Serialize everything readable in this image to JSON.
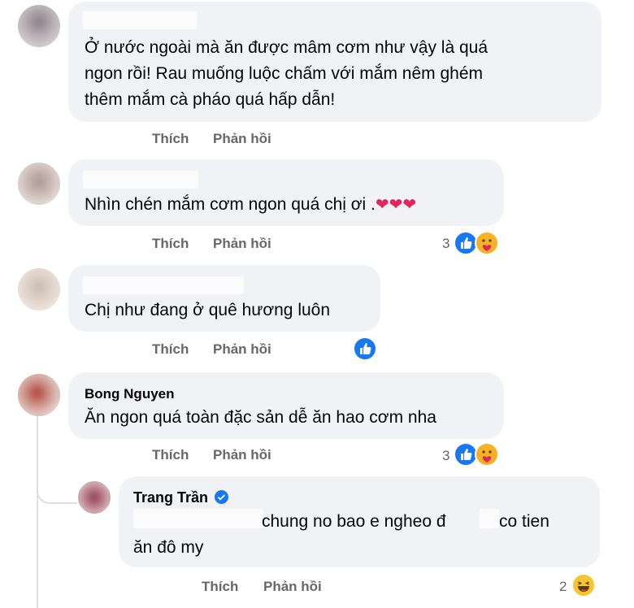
{
  "comments": [
    {
      "text_lines": [
        "Ở nước ngoài mà ăn được mâm cơm như vậy là quá",
        "ngon rồi! Rau muống luộc chấm với mắm nêm ghém",
        "thêm mắm cà pháo quá hấp dẫn!"
      ],
      "actions": {
        "like": "Thích",
        "reply": "Phản hồi"
      }
    },
    {
      "text": "Nhìn chén mắm cơm ngon quá chị ơi .",
      "hearts": "❤❤❤",
      "actions": {
        "like": "Thích",
        "reply": "Phản hồi"
      },
      "reaction_count": "3",
      "reactions": [
        "like-icon",
        "care-icon"
      ]
    },
    {
      "text": "Chị như đang ở quê hương luôn",
      "actions": {
        "like": "Thích",
        "reply": "Phản hồi"
      },
      "reactions": [
        "like-icon"
      ]
    },
    {
      "author": "Bong Nguyen",
      "text": "Ăn ngon quá toàn đặc sản dễ ăn hao cơm nha",
      "actions": {
        "like": "Thích",
        "reply": "Phản hồi"
      },
      "reaction_count": "3",
      "reactions": [
        "like-icon",
        "care-icon"
      ]
    }
  ],
  "reply": {
    "author": "Trang Trần",
    "verified_icon": "verified-badge-icon",
    "text_line1_part1": "chung no bao e ngheo đ",
    "text_line1_part2": "co tien",
    "text_line2": "ăn đô my",
    "actions": {
      "like": "Thích",
      "reply": "Phản hồi"
    },
    "reaction_count": "2",
    "reactions": [
      "haha-icon"
    ]
  },
  "colors": {
    "bubble": "#f0f2f5",
    "action_text": "#65676b",
    "like_blue": "#1877f2",
    "heart_red": "#e0245e"
  }
}
